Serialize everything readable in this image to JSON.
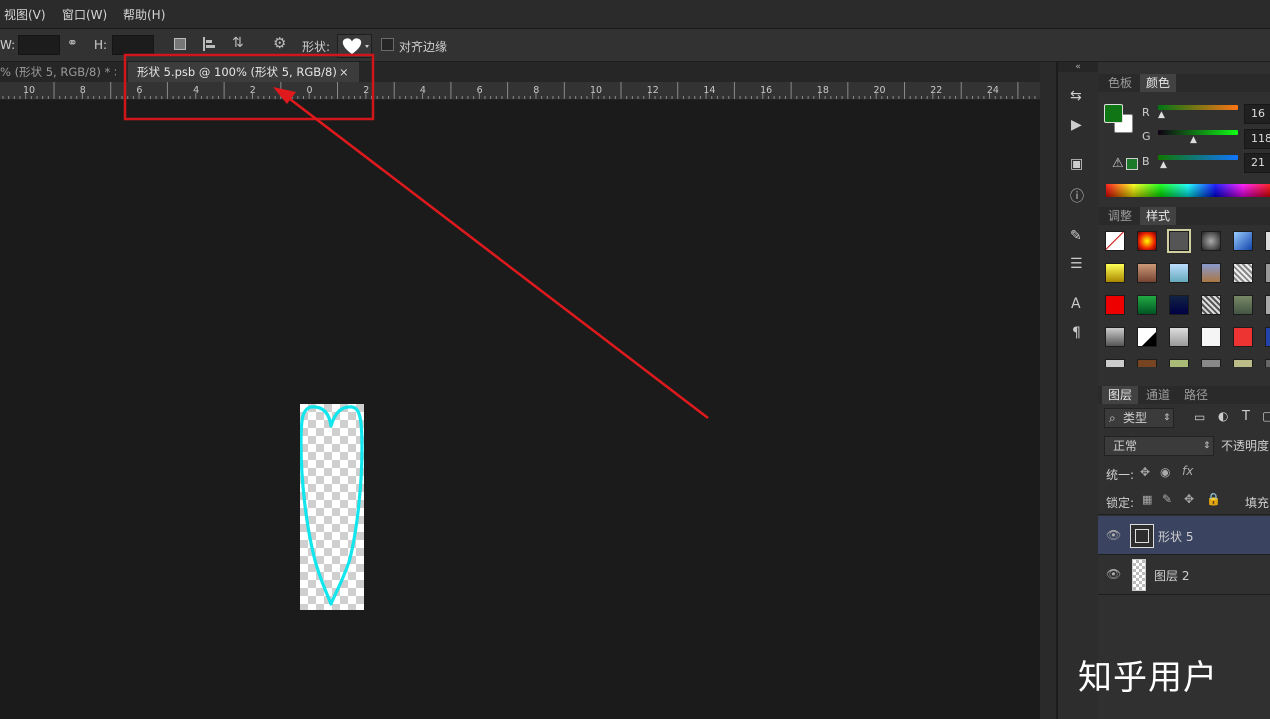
{
  "menu": {
    "items": [
      "视图(V)",
      "窗口(W)",
      "帮助(H)"
    ]
  },
  "options": {
    "w_label": "W:",
    "h_label": "H:",
    "shape_label": "形状:",
    "align_edges_label": "对齐边缘"
  },
  "tabs": {
    "inactive_label": "% (形状 5, RGB/8) *",
    "active_label": "形状 5.psb @ 100% (形状 5, RGB/8)",
    "close_glyph": "×"
  },
  "ruler": {
    "labels": [
      "10",
      "8",
      "6",
      "4",
      "2",
      "0",
      "2",
      "4",
      "6",
      "8",
      "10",
      "12",
      "14",
      "16",
      "18",
      "20",
      "22",
      "24"
    ]
  },
  "color_panel": {
    "tabs": [
      "色板",
      "颜色"
    ],
    "active_tab": "颜色",
    "r_label": "R",
    "g_label": "G",
    "b_label": "B",
    "r_value": "16",
    "g_value": "118",
    "b_value": "21",
    "foreground_color": "#107615",
    "background_color": "#ffffff"
  },
  "styles_panel": {
    "tabs": [
      "调整",
      "样式"
    ],
    "active_tab": "样式"
  },
  "layers_panel": {
    "tabs": [
      "图层",
      "通道",
      "路径"
    ],
    "active_tab": "图层",
    "filter_label": "类型",
    "blend_mode": "正常",
    "opacity_label": "不透明度",
    "unify_label": "统一:",
    "lock_label": "锁定:",
    "fill_label": "填充",
    "layers": [
      {
        "name": "形状 5",
        "selected": true
      },
      {
        "name": "图层 2",
        "selected": false
      }
    ]
  },
  "colors": {
    "highlight_box": "#d0161a",
    "arrow": "#e0191c",
    "heart_stroke": "#12e6ec"
  },
  "watermark": "知乎用户"
}
